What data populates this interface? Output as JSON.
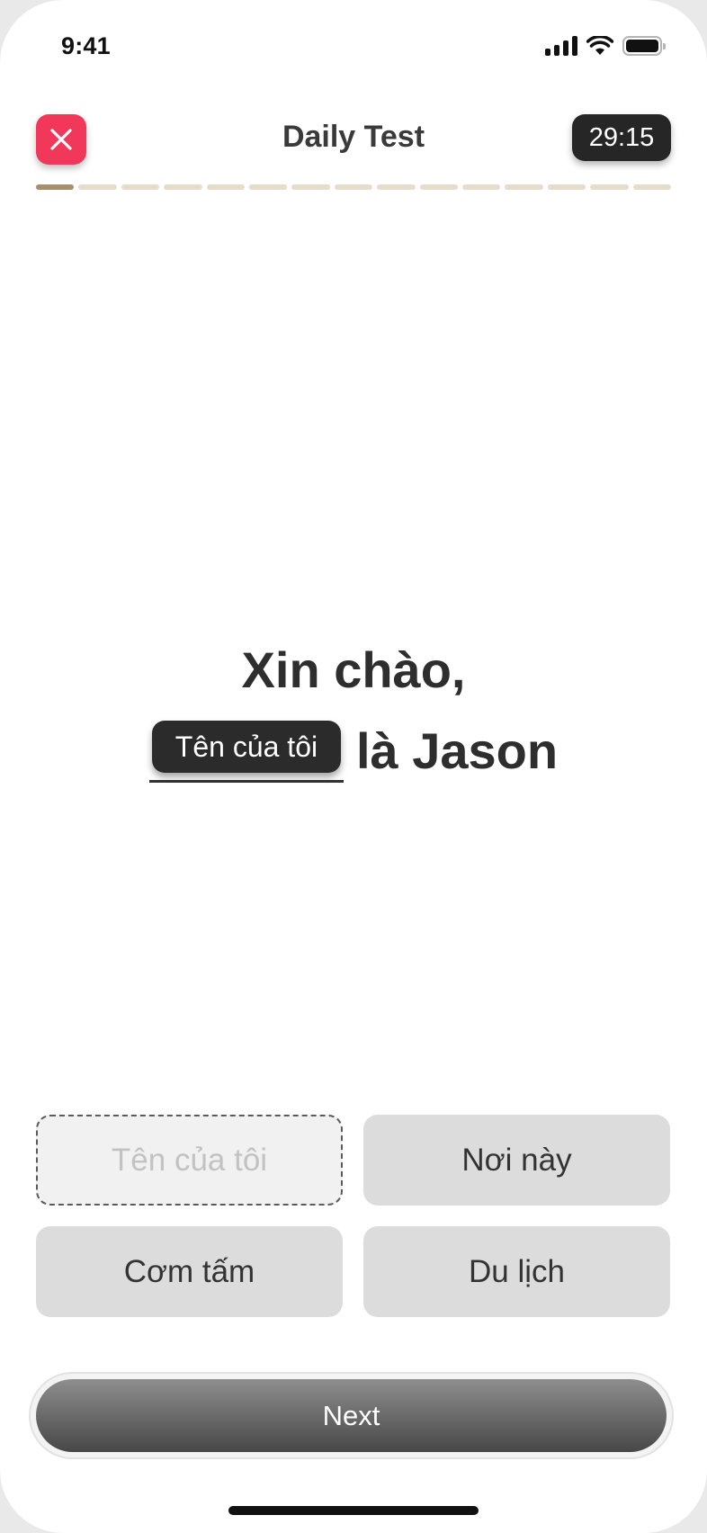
{
  "status_bar": {
    "time": "9:41",
    "icons": [
      "signal-icon",
      "wifi-icon",
      "battery-icon"
    ]
  },
  "header": {
    "close_icon": "close-icon",
    "title": "Daily Test",
    "timer": "29:15"
  },
  "progress": {
    "total_segments": 15,
    "completed_segments": 1,
    "completed_color": "#a88f6c",
    "remaining_color": "#e6dccb"
  },
  "question": {
    "line1": "Xin chào,",
    "filled_blank": "Tên của tôi",
    "rest": "là Jason"
  },
  "options": [
    {
      "label": "Tên của tôi",
      "state": "used"
    },
    {
      "label": "Nơi này",
      "state": "available"
    },
    {
      "label": "Cơm tấm",
      "state": "available"
    },
    {
      "label": "Du lịch",
      "state": "available"
    }
  ],
  "footer": {
    "next_label": "Next"
  },
  "colors": {
    "close_button": "#f2385a",
    "timer_bg": "#262626",
    "option_bg": "#dcdcdc"
  }
}
